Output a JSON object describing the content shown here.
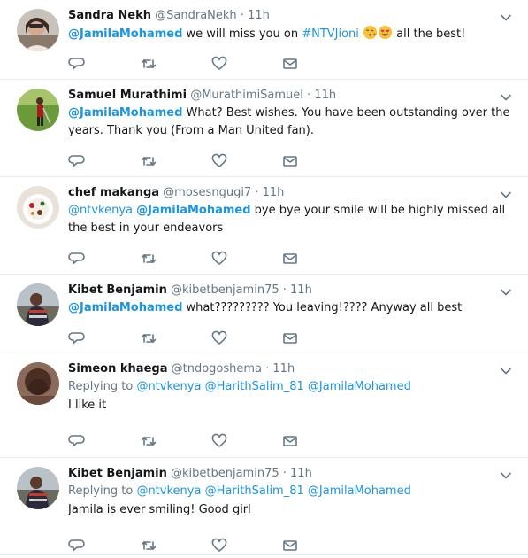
{
  "tweets": [
    {
      "name": "Sandra Nekh",
      "handle": "@SandraNekh",
      "time": "11h",
      "parts": [
        {
          "t": "@JamilaMohamed",
          "k": "mention"
        },
        {
          "t": " we will miss you on ",
          "k": "text"
        },
        {
          "t": "#NTVJioni",
          "k": "link"
        },
        {
          "t": " ",
          "k": "text"
        },
        {
          "t": "kiss-emoji",
          "k": "emoji"
        },
        {
          "t": "heart-eyes-emoji",
          "k": "emoji"
        },
        {
          "t": " all the best!",
          "k": "text"
        }
      ]
    },
    {
      "name": "Samuel Murathimi",
      "handle": "@MurathimiSamuel",
      "time": "11h",
      "parts": [
        {
          "t": "@JamilaMohamed",
          "k": "mention"
        },
        {
          "t": " What? Best wishes. You have been outstanding over the years. Thank you (From a Man United fan).",
          "k": "text"
        }
      ]
    },
    {
      "name": "chef makanga",
      "handle": "@mosesngugi7",
      "time": "11h",
      "parts": [
        {
          "t": "@ntvkenya",
          "k": "link"
        },
        {
          "t": " ",
          "k": "text"
        },
        {
          "t": "@JamilaMohamed",
          "k": "mention"
        },
        {
          "t": "  bye bye your smile will be highly missed all the best in your endeavors",
          "k": "text"
        }
      ]
    },
    {
      "name": "Kibet Benjamin",
      "handle": "@kibetbenjamin75",
      "time": "11h",
      "parts": [
        {
          "t": "@JamilaMohamed",
          "k": "mention"
        },
        {
          "t": " what????????? You leaving!???? Anyway all best",
          "k": "text"
        }
      ]
    },
    {
      "name": "Simeon khaega",
      "handle": "@tndogoshema",
      "time": "11h",
      "replying_label": "Replying to",
      "replying_to": [
        "@ntvkenya",
        "@HarithSalim_81",
        "@JamilaMohamed"
      ],
      "parts": [
        {
          "t": "I like it",
          "k": "text"
        }
      ]
    },
    {
      "name": "Kibet Benjamin",
      "handle": "@kibetbenjamin75",
      "time": "11h",
      "replying_label": "Replying to",
      "replying_to": [
        "@ntvkenya",
        "@HarithSalim_81",
        "@JamilaMohamed"
      ],
      "parts": [
        {
          "t": "Jamila is ever smiling! Good girl",
          "k": "text"
        }
      ]
    }
  ],
  "icons": {
    "reply": "reply-icon",
    "retweet": "retweet-icon",
    "like": "heart-icon",
    "dm": "envelope-icon",
    "more": "chevron-down-icon"
  },
  "colors": {
    "link": "#1b95e0",
    "muted": "#657786",
    "text": "#14171a",
    "divider": "#e6ecf0"
  }
}
